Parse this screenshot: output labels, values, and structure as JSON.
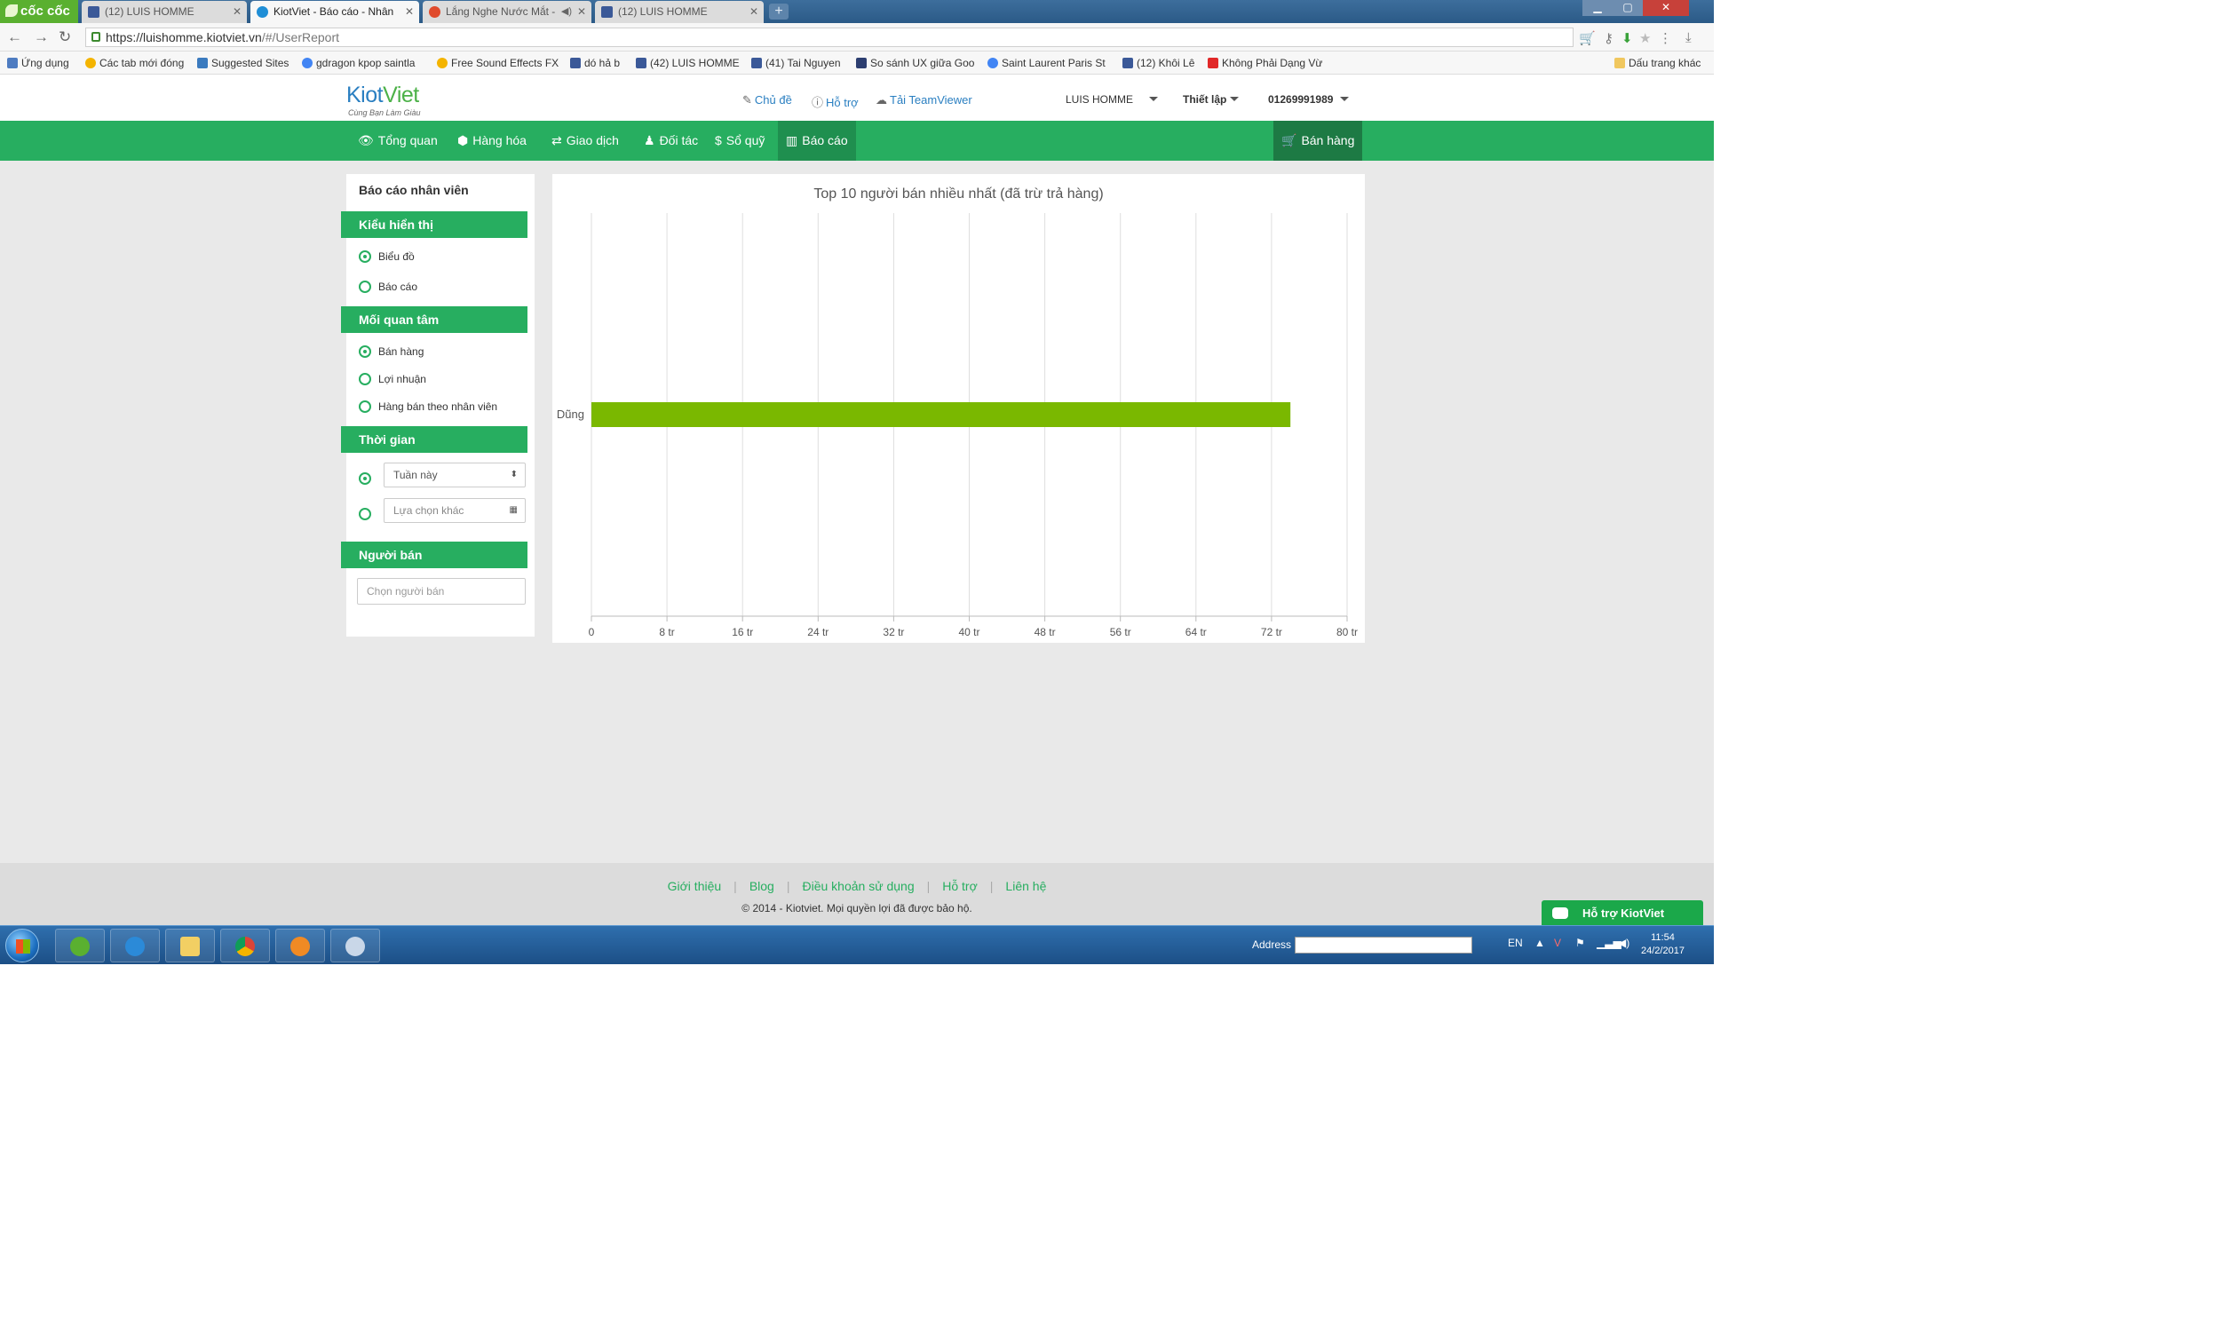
{
  "browser": {
    "brand": "cốc cốc",
    "tabs": [
      {
        "title": "(12) LUIS HOMME",
        "icon": "facebook-icon"
      },
      {
        "title": "KiotViet - Báo cáo - Nhân",
        "icon": "kiotviet-icon",
        "active": true
      },
      {
        "title": "Lắng Nghe Nước Mắt -",
        "icon": "music-icon"
      },
      {
        "title": "(12) LUIS HOMME",
        "icon": "facebook-icon"
      }
    ],
    "url_host": "https://luishomme.kiotviet.vn",
    "url_path": "/#/UserReport",
    "bookmarks": [
      {
        "label": "Ứng dụng",
        "icon": "apps"
      },
      {
        "label": "Các tab mới đóng",
        "icon": "sl"
      },
      {
        "label": "Suggested Sites",
        "icon": "b"
      },
      {
        "label": "gdragon kpop saintla",
        "icon": "g"
      },
      {
        "label": "Free Sound Effects FX",
        "icon": "sl"
      },
      {
        "label": "dó hả b",
        "icon": "fb"
      },
      {
        "label": "(42) LUIS HOMME",
        "icon": "fb"
      },
      {
        "label": "(41) Tai Nguyen",
        "icon": "fb"
      },
      {
        "label": "So sánh UX giữa Goo",
        "icon": "k"
      },
      {
        "label": "Saint Laurent Paris St",
        "icon": "g"
      },
      {
        "label": "(12) Khôi Lê",
        "icon": "fb"
      },
      {
        "label": "Không Phải Dạng Vừ",
        "icon": "yt"
      }
    ],
    "other_bookmarks": "Dấu trang khác"
  },
  "header": {
    "logo_kiot": "Kiot",
    "logo_viet": "Viet",
    "slogan": "Cùng Bạn Làm Giàu",
    "theme": "Chủ đề",
    "help": "Hỗ trợ",
    "teamviewer": "Tải TeamViewer",
    "user": "LUIS HOMME",
    "settings": "Thiết lập",
    "phone": "01269991989"
  },
  "nav": {
    "overview": "Tổng quan",
    "products": "Hàng hóa",
    "transactions": "Giao dịch",
    "partners": "Đối tác",
    "cashbook": "Sổ quỹ",
    "reports": "Báo cáo",
    "sell": "Bán hàng"
  },
  "sidebar": {
    "title": "Báo cáo nhân viên",
    "display_head": "Kiểu hiển thị",
    "display_chart": "Biểu đồ",
    "display_report": "Báo cáo",
    "concern_head": "Mối quan tâm",
    "concern_sales": "Bán hàng",
    "concern_profit": "Lợi nhuận",
    "concern_items": "Hàng bán theo nhân viên",
    "time_head": "Thời gian",
    "time_week": "Tuần này",
    "time_other": "Lựa chọn khác",
    "seller_head": "Người bán",
    "seller_placeholder": "Chọn người bán"
  },
  "chart_data": {
    "type": "bar",
    "orientation": "horizontal",
    "title": "Top 10 người bán nhiều nhất (đã trừ trả hàng)",
    "categories": [
      "Dũng"
    ],
    "values": [
      74
    ],
    "value_unit": "tr",
    "xlim": [
      0,
      80
    ],
    "ticks": [
      0,
      8,
      16,
      24,
      32,
      40,
      48,
      56,
      64,
      72,
      80
    ],
    "tick_labels": [
      "0",
      "8 tr",
      "16 tr",
      "24 tr",
      "32 tr",
      "40 tr",
      "48 tr",
      "56 tr",
      "64 tr",
      "72 tr",
      "80 tr"
    ],
    "grid": true,
    "bar_color": "#7ab800"
  },
  "footer": {
    "intro": "Giới thiệu",
    "blog": "Blog",
    "terms": "Điều khoản sử dụng",
    "support": "Hỗ trợ",
    "contact": "Liên hệ",
    "copyright": "© 2014 - Kiotviet. Mọi quyền lợi đã được bảo hộ.",
    "support_widget": "Hỗ trợ KiotViet"
  },
  "taskbar": {
    "address_label": "Address",
    "lang": "EN",
    "time": "11:54",
    "date": "24/2/2017"
  },
  "colors": {
    "brand_green": "#27ae60",
    "bar_green": "#7ab800",
    "link_blue": "#2a7fc1"
  }
}
